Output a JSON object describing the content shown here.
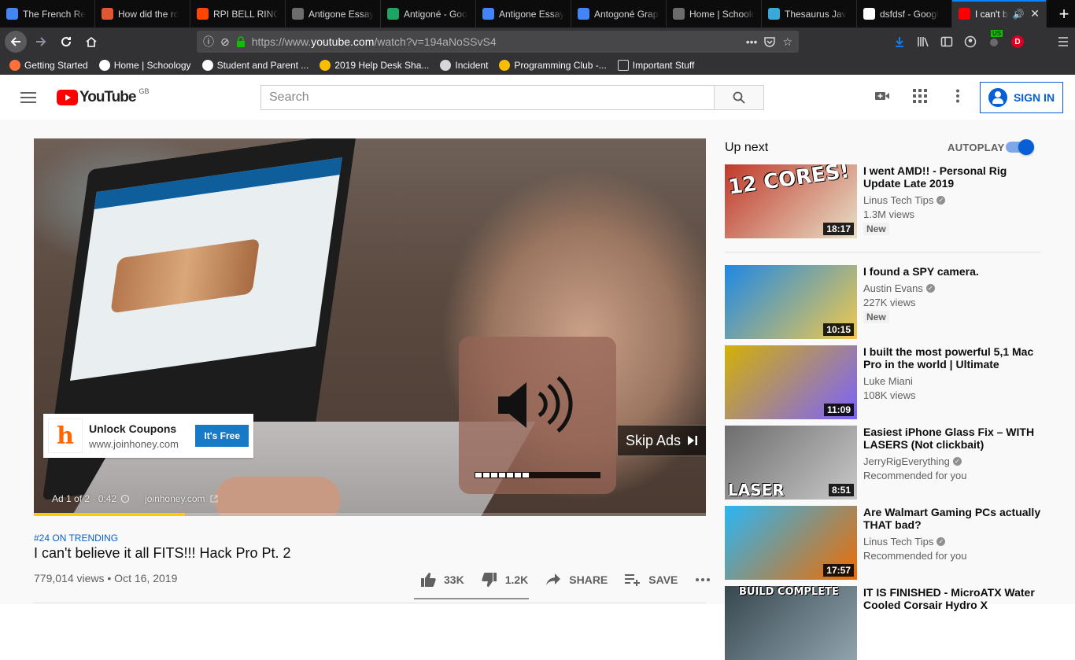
{
  "browser": {
    "tabs": [
      {
        "title": "The French Re",
        "icon": "docs-icon",
        "color": "#4285f4"
      },
      {
        "title": "How did the ro",
        "icon": "duckduckgo-icon",
        "color": "#de5833"
      },
      {
        "title": "RPI BELL RING",
        "icon": "reddit-icon",
        "color": "#ff4500"
      },
      {
        "title": "Antigone Essay",
        "icon": "schoology-icon",
        "color": "#6c6c6c"
      },
      {
        "title": "Antigoné - Goo",
        "icon": "drive-icon",
        "color": "#1fa463"
      },
      {
        "title": "Antigone Essay",
        "icon": "docs-icon",
        "color": "#4285f4"
      },
      {
        "title": "Antogoné Grapl",
        "icon": "docs-icon",
        "color": "#4285f4"
      },
      {
        "title": "Home | Schoolo",
        "icon": "schoology-icon",
        "color": "#6c6c6c"
      },
      {
        "title": "Thesaurus Jav",
        "icon": "puzzle-icon",
        "color": "#3aa8d8"
      },
      {
        "title": "dsfdsf - Googl",
        "icon": "google-icon",
        "color": "#ffffff"
      },
      {
        "title": "I can't b",
        "icon": "youtube-icon",
        "color": "#ff0000",
        "active": true
      }
    ],
    "new_tab": "+",
    "url_prefix": "https://www.",
    "url_domain": "youtube.com",
    "url_path": "/watch?v=194aNoSSvS4",
    "bookmarks": [
      {
        "label": "Getting Started",
        "icon": "firefox-icon",
        "color": "#ff7139"
      },
      {
        "label": "Home | Schoology",
        "icon": "schoology-icon",
        "color": "#ffffff"
      },
      {
        "label": "Student and Parent ...",
        "icon": "portal-icon",
        "color": "#f9f9fa"
      },
      {
        "label": "2019 Help Desk Sha...",
        "icon": "drive-icon",
        "color": "#fbbc04"
      },
      {
        "label": "Incident",
        "icon": "globe-icon",
        "color": "#d7d7db"
      },
      {
        "label": "Programming Club -...",
        "icon": "drive-icon",
        "color": "#fbbc04"
      },
      {
        "label": "Important Stuff",
        "icon": "folder-icon",
        "color": "#d7d7db"
      }
    ],
    "extension_badge": "US",
    "profile_letter": "D"
  },
  "header": {
    "logo_text": "YouTube",
    "region": "GB",
    "search_placeholder": "Search",
    "signin_label": "SIGN IN"
  },
  "player": {
    "ad_title": "Unlock Coupons",
    "ad_url": "www.joinhoney.com",
    "ad_cta": "It's Free",
    "ad_logo_letter": "h",
    "skip_label": "Skip Ads",
    "ad_counter": "Ad 1 of 2 · 0:42",
    "ad_domain": "joinhoney.com",
    "volume_level": 0.45,
    "progress": 0.225
  },
  "video": {
    "trending": "#24 ON TRENDING",
    "title": "I can't believe it all FITS!!! Hack Pro Pt. 2",
    "stats": "779,014 views • Oct 16, 2019",
    "likes": "33K",
    "dislikes": "1.2K",
    "share": "SHARE",
    "save": "SAVE"
  },
  "sidebar": {
    "up_next": "Up next",
    "autoplay": "AUTOPLAY",
    "autoplay_on": true,
    "items": [
      {
        "title": "I went AMD!! - Personal Rig Update Late 2019",
        "channel": "Linus Tech Tips",
        "verified": true,
        "views": "1.3M views",
        "badge": "New",
        "duration": "18:17",
        "overlay": "12 CORES!",
        "thumb_colors": [
          "#c0392b",
          "#e8e0c8"
        ]
      },
      {
        "title": "I found a SPY camera.",
        "channel": "Austin Evans",
        "verified": true,
        "views": "227K views",
        "badge": "New",
        "duration": "10:15",
        "overlay": "",
        "thumb_colors": [
          "#1e88e5",
          "#f2c94c"
        ]
      },
      {
        "title": "I built the most powerful 5,1 Mac Pro in the world | Ultimate",
        "channel": "Luke Miani",
        "verified": false,
        "views": "108K views",
        "badge": "",
        "duration": "11:09",
        "overlay": "",
        "thumb_colors": [
          "#d4b106",
          "#7b61ff"
        ]
      },
      {
        "title": "Easiest iPhone Glass Fix – WITH LASERS (Not clickbait)",
        "channel": "JerryRigEverything",
        "verified": true,
        "views": "Recommended for you",
        "badge": "",
        "duration": "8:51",
        "overlay": "LASER",
        "thumb_colors": [
          "#6d6d6d",
          "#c9c9c9"
        ]
      },
      {
        "title": "Are Walmart Gaming PCs actually THAT bad?",
        "channel": "Linus Tech Tips",
        "verified": true,
        "views": "Recommended for you",
        "badge": "",
        "duration": "17:57",
        "overlay": "",
        "thumb_colors": [
          "#29b6f6",
          "#ef6c00"
        ]
      },
      {
        "title": "IT IS FINISHED - MicroATX Water Cooled Corsair Hydro X",
        "channel": "",
        "verified": false,
        "views": "",
        "badge": "",
        "duration": "",
        "overlay": "BUILD COMPLETE",
        "thumb_colors": [
          "#37474f",
          "#90a4ae"
        ]
      }
    ]
  }
}
